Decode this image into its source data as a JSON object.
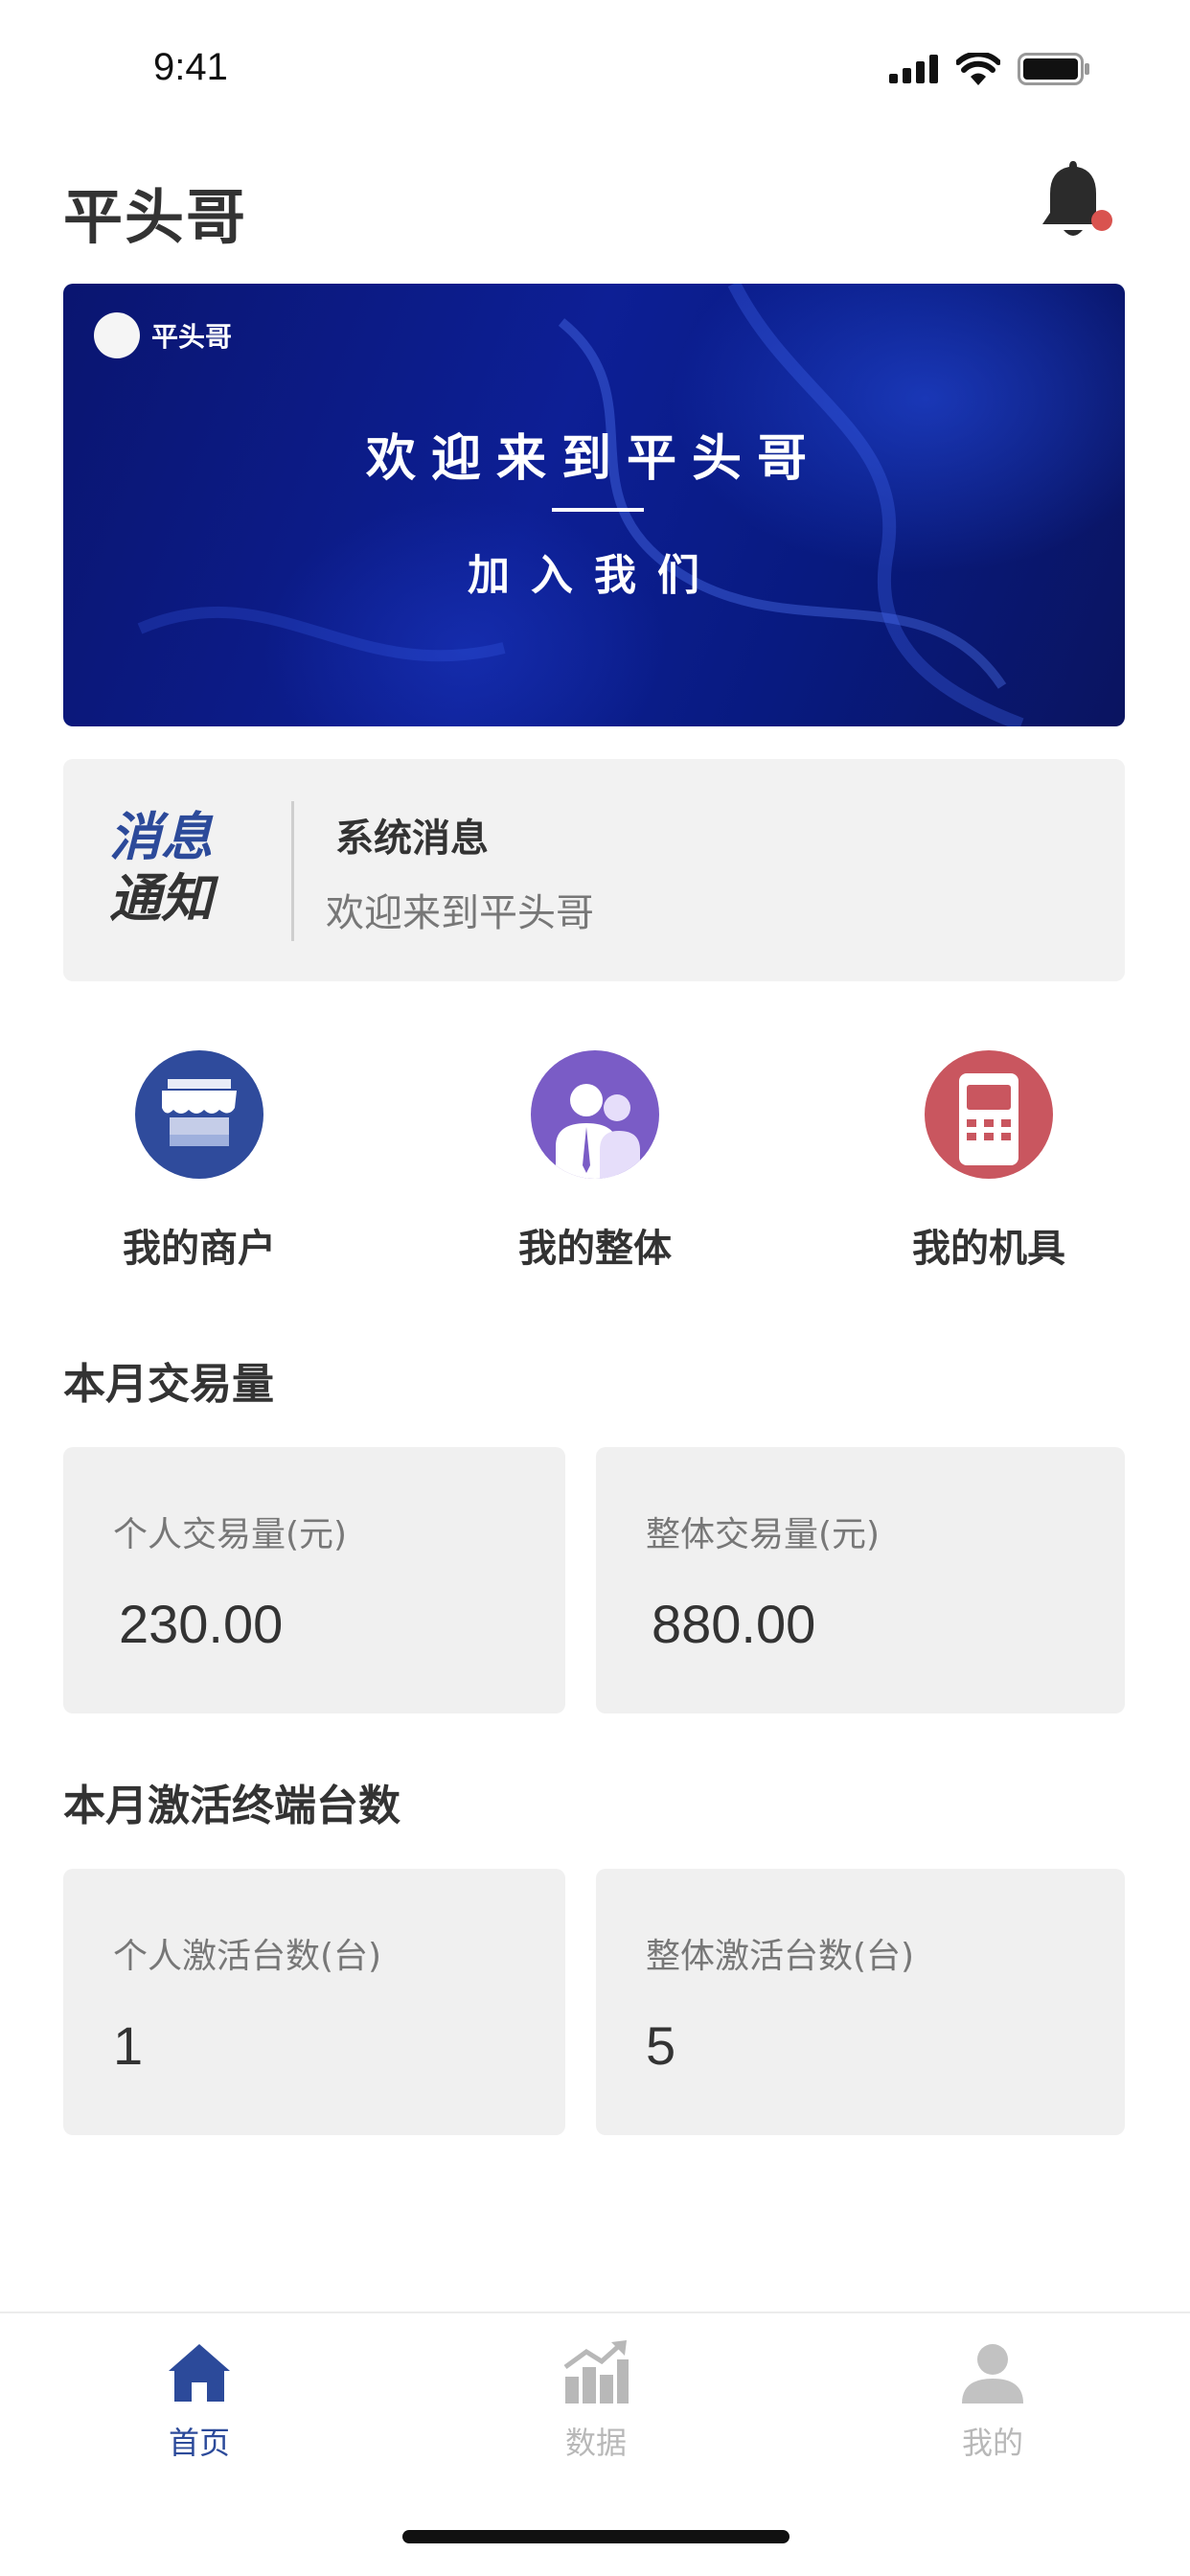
{
  "status_bar": {
    "time": "9:41"
  },
  "header": {
    "title": "平头哥"
  },
  "banner": {
    "logo_text": "平头哥",
    "headline": "欢迎来到平头哥",
    "subline": "加入我们"
  },
  "notice": {
    "tag_line1": "消息",
    "tag_line2": "通知",
    "title": "系统消息",
    "message": "欢迎来到平头哥"
  },
  "quick_actions": [
    {
      "label": "我的商户",
      "icon": "storefront-icon",
      "color": "#2f4b9c"
    },
    {
      "label": "我的整体",
      "icon": "team-icon",
      "color": "#7a5cc6"
    },
    {
      "label": "我的机具",
      "icon": "pos-terminal-icon",
      "color": "#c9565f"
    }
  ],
  "transactions": {
    "title": "本月交易量",
    "personal_label": "个人交易量(元)",
    "personal_value": "230.00",
    "overall_label": "整体交易量(元)",
    "overall_value": "880.00"
  },
  "activations": {
    "title": "本月激活终端台数",
    "personal_label": "个人激活台数(台)",
    "personal_value": "1",
    "overall_label": "整体激活台数(台)",
    "overall_value": "5"
  },
  "tabbar": [
    {
      "label": "首页",
      "icon": "home-icon",
      "active": true
    },
    {
      "label": "数据",
      "icon": "chart-icon",
      "active": false
    },
    {
      "label": "我的",
      "icon": "user-icon",
      "active": false
    }
  ],
  "colors": {
    "accent": "#2c4a9a",
    "notification_dot": "#d9534f",
    "tab_inactive": "#b8b8b8",
    "card_bg": "#f0f0f0"
  }
}
